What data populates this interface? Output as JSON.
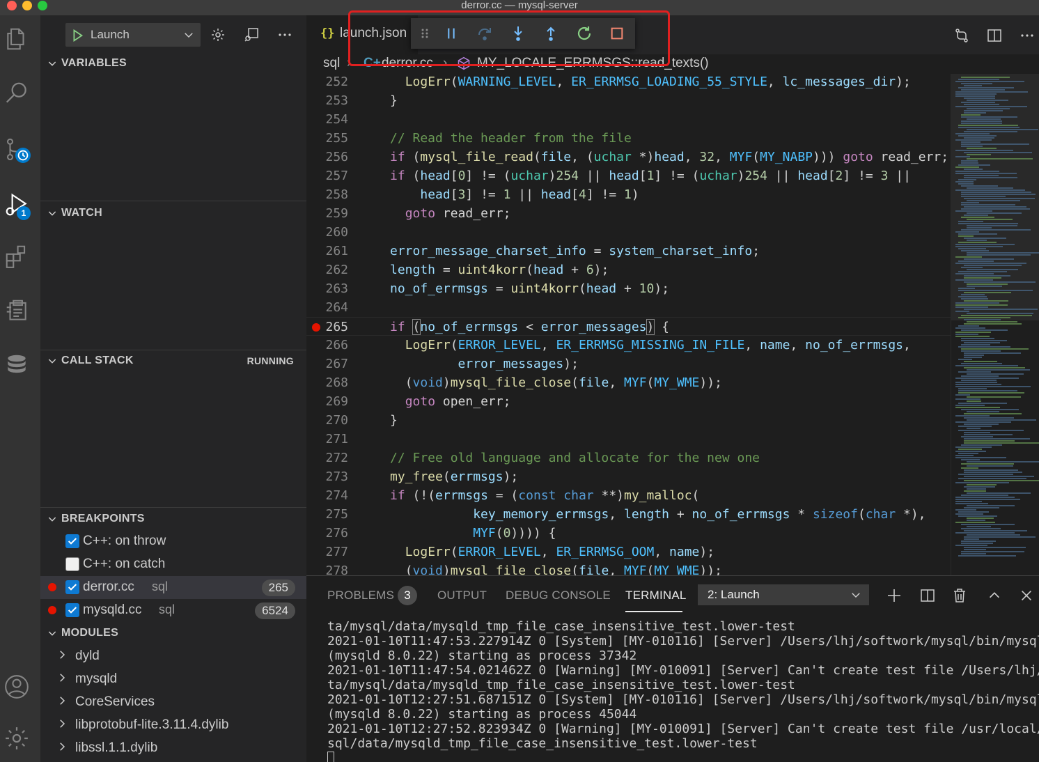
{
  "window": {
    "title": "derror.cc — mysql-server"
  },
  "activity_bar": {
    "debug_badge": "1"
  },
  "sidebar": {
    "launch_config": "Launch",
    "sections": {
      "variables": "VARIABLES",
      "watch": "WATCH",
      "call_stack": "CALL STACK",
      "call_stack_status": "RUNNING",
      "breakpoints": "BREAKPOINTS",
      "modules": "MODULES"
    },
    "breakpoints": [
      {
        "label": "C++: on throw",
        "checked": true,
        "file": "",
        "line": ""
      },
      {
        "label": "C++: on catch",
        "checked": false,
        "file": "",
        "line": ""
      },
      {
        "label": "derror.cc",
        "checked": true,
        "file": "sql",
        "line": "265"
      },
      {
        "label": "mysqld.cc",
        "checked": true,
        "file": "sql",
        "line": "6524"
      }
    ],
    "modules": [
      "dyld",
      "mysqld",
      "CoreServices",
      "libprotobuf-lite.3.11.4.dylib",
      "libssl.1.1.dylib"
    ]
  },
  "editor": {
    "tab_label": "launch.json",
    "tab_label_visible_prefix": "la",
    "tab_label_visible_suffix": "unch.json",
    "breadcrumb": {
      "folder": "sql",
      "file": "derror.cc",
      "symbol": "MY_LOCALE_ERRMSGS::read_texts()"
    },
    "lines": [
      "252",
      "253",
      "254",
      "255",
      "256",
      "257",
      "258",
      "259",
      "260",
      "261",
      "262",
      "263",
      "264",
      "265",
      "266",
      "267",
      "268",
      "269",
      "270",
      "271",
      "272",
      "273",
      "274",
      "275",
      "276",
      "277",
      "278"
    ],
    "breakpoint_line": "265"
  },
  "panel": {
    "tabs": {
      "problems": "PROBLEMS",
      "problems_count": "3",
      "output": "OUTPUT",
      "debug_console": "DEBUG CONSOLE",
      "terminal": "TERMINAL"
    },
    "terminal_select": "2: Launch",
    "terminal_lines": [
      "ta/mysql/data/mysqld_tmp_file_case_insensitive_test.lower-test",
      "2021-01-10T11:47:53.227914Z 0 [System] [MY-010116] [Server] /Users/lhj/softwork/mysql/bin/mysqld",
      "(mysqld 8.0.22) starting as process 37342",
      "2021-01-10T11:47:54.021462Z 0 [Warning] [MY-010091] [Server] Can't create test file /Users/lhj/da",
      "ta/mysql/data/mysqld_tmp_file_case_insensitive_test.lower-test",
      "2021-01-10T12:27:51.687151Z 0 [System] [MY-010116] [Server] /Users/lhj/softwork/mysql/bin/mysqld",
      "(mysqld 8.0.22) starting as process 45044",
      "2021-01-10T12:27:52.823934Z 0 [Warning] [MY-010091] [Server] Can't create test file /usr/local/my",
      "sql/data/mysqld_tmp_file_case_insensitive_test.lower-test"
    ]
  },
  "colors": {
    "accent": "#007acc",
    "breakpoint": "#e51400",
    "highlight_box": "#e02020"
  }
}
